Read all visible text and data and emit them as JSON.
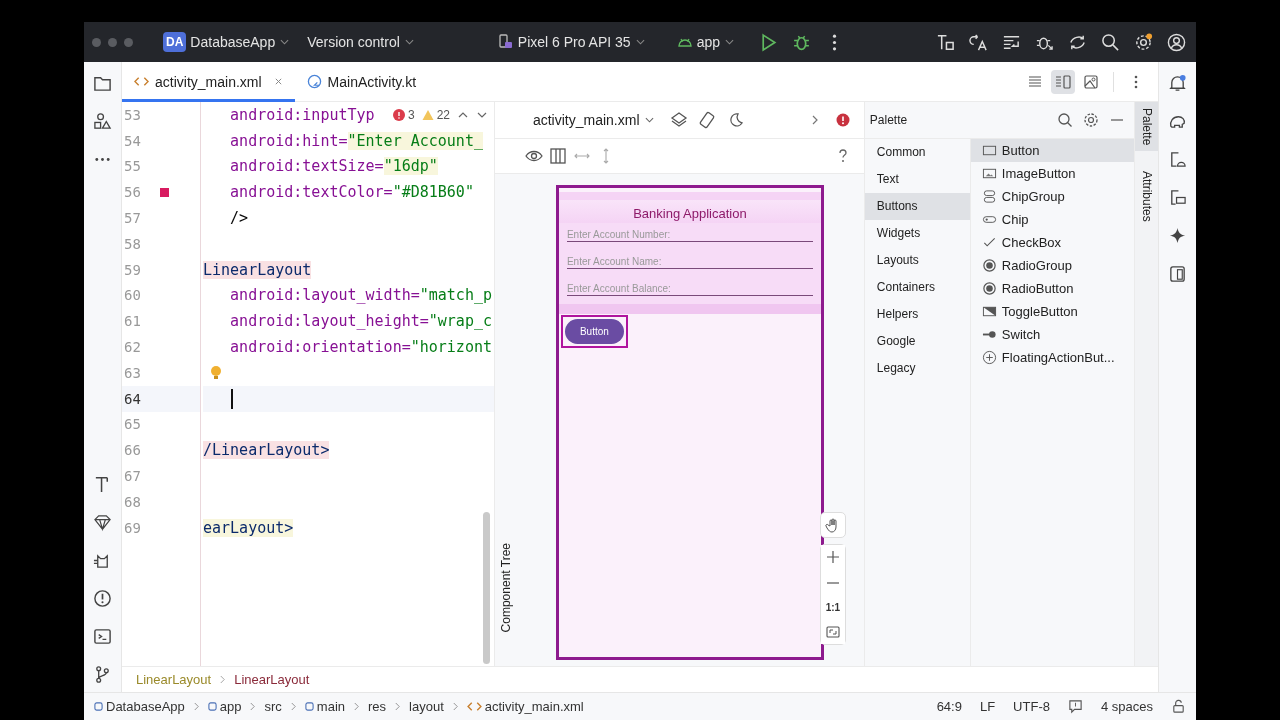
{
  "title_bar": {
    "project_badge": "DA",
    "project": "DatabaseApp",
    "vcs": "Version control",
    "device": "Pixel 6 Pro API 35",
    "run_config": "app"
  },
  "tabs": [
    {
      "label": "activity_main.xml",
      "selected": true,
      "closable": true
    },
    {
      "label": "MainActivity.kt",
      "selected": false,
      "closable": false
    }
  ],
  "editor": {
    "inspections": {
      "errors": "3",
      "warnings": "22"
    },
    "lines": [
      {
        "number": "53",
        "segments": [
          {
            "text": "   android:inputTyp",
            "kind": "attr"
          }
        ]
      },
      {
        "number": "54",
        "segments": [
          {
            "text": "   android:hint=",
            "kind": "attr"
          },
          {
            "text": "\"Enter Account_",
            "kind": "value-hl"
          }
        ]
      },
      {
        "number": "55",
        "segments": [
          {
            "text": "   android:textSize=",
            "kind": "attr"
          },
          {
            "text": "\"16dp\"",
            "kind": "value-hl"
          }
        ]
      },
      {
        "number": "56",
        "color": "#d81b60",
        "segments": [
          {
            "text": "   android:textColor=",
            "kind": "attr"
          },
          {
            "text": "\"#D81B60\"",
            "kind": "value"
          }
        ]
      },
      {
        "number": "57",
        "segments": [
          {
            "text": "   />",
            "kind": "plain"
          }
        ]
      },
      {
        "number": "58"
      },
      {
        "number": "59",
        "segments": [
          {
            "text": "LinearLayout",
            "kind": "tag-error"
          }
        ]
      },
      {
        "number": "60",
        "segments": [
          {
            "text": "   android:layout_width=",
            "kind": "attr"
          },
          {
            "text": "\"match_p",
            "kind": "value"
          }
        ]
      },
      {
        "number": "61",
        "segments": [
          {
            "text": "   android:layout_height=",
            "kind": "attr"
          },
          {
            "text": "\"wrap_c",
            "kind": "value"
          }
        ]
      },
      {
        "number": "62",
        "segments": [
          {
            "text": "   android:orientation=",
            "kind": "attr"
          },
          {
            "text": "\"horizont",
            "kind": "value"
          }
        ]
      },
      {
        "number": "63",
        "bulb": true
      },
      {
        "number": "64",
        "current": true
      },
      {
        "number": "65"
      },
      {
        "number": "66",
        "segments": [
          {
            "text": "/LinearLayout>",
            "kind": "tag-error"
          }
        ]
      },
      {
        "number": "67"
      },
      {
        "number": "68"
      },
      {
        "number": "69",
        "segments": [
          {
            "text": "earLayout>",
            "kind": "tag-hl"
          }
        ]
      }
    ]
  },
  "design": {
    "file": "activity_main.xml",
    "component_tree": "Component Tree",
    "zoom_reset": "1:1",
    "phone": {
      "title": "Banking Application",
      "fields": [
        {
          "placeholder": "Enter Account Number:"
        },
        {
          "placeholder": "Enter Account Name:"
        },
        {
          "placeholder": "Enter Account Balance:"
        }
      ],
      "button": "Button"
    }
  },
  "palette": {
    "title": "Palette",
    "categories": [
      {
        "label": "Common",
        "selected": false
      },
      {
        "label": "Text",
        "selected": false
      },
      {
        "label": "Buttons",
        "selected": true
      },
      {
        "label": "Widgets",
        "selected": false
      },
      {
        "label": "Layouts",
        "selected": false
      },
      {
        "label": "Containers",
        "selected": false
      },
      {
        "label": "Helpers",
        "selected": false
      },
      {
        "label": "Google",
        "selected": false
      },
      {
        "label": "Legacy",
        "selected": false
      }
    ],
    "items": [
      {
        "label": "Button",
        "kind": "button",
        "selected": true
      },
      {
        "label": "ImageButton",
        "kind": "image",
        "selected": false
      },
      {
        "label": "ChipGroup",
        "kind": "chipgroup",
        "selected": false
      },
      {
        "label": "Chip",
        "kind": "chip",
        "selected": false
      },
      {
        "label": "CheckBox",
        "kind": "check",
        "selected": false
      },
      {
        "label": "RadioGroup",
        "kind": "radio",
        "selected": false
      },
      {
        "label": "RadioButton",
        "kind": "radio",
        "selected": false
      },
      {
        "label": "ToggleButton",
        "kind": "toggle",
        "selected": false
      },
      {
        "label": "Switch",
        "kind": "switch",
        "selected": false
      },
      {
        "label": "FloatingActionBut...",
        "kind": "fab",
        "selected": false
      }
    ]
  },
  "side_tabs": [
    {
      "label": "Palette",
      "selected": true
    },
    {
      "label": "Attributes",
      "selected": false
    }
  ],
  "breadcrumb": [
    "LinearLayout",
    "LinearLayout"
  ],
  "status_bar": {
    "path": [
      {
        "label": "DatabaseApp",
        "kind": "module"
      },
      {
        "label": "app",
        "kind": "module"
      },
      {
        "label": "src",
        "kind": "folder"
      },
      {
        "label": "main",
        "kind": "module"
      },
      {
        "label": "res",
        "kind": "folder"
      },
      {
        "label": "layout",
        "kind": "folder"
      },
      {
        "label": "activity_main.xml",
        "kind": "xml"
      }
    ],
    "position": "64:9",
    "line_ending": "LF",
    "encoding": "UTF-8",
    "indent": "4 spaces"
  }
}
